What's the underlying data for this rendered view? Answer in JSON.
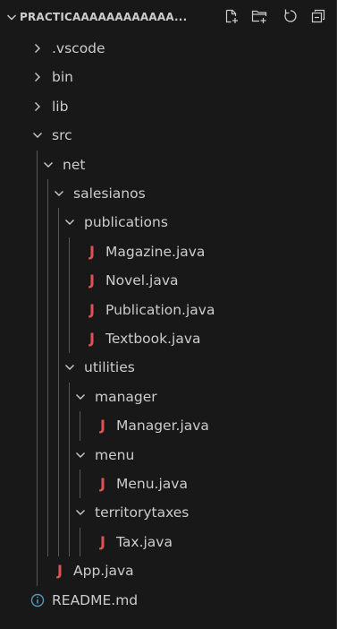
{
  "explorer": {
    "folder_title": "PRACTICAAAAAAAAAAAA...",
    "toolbar": {
      "new_file": "new-file-icon",
      "new_folder": "new-folder-icon",
      "refresh": "refresh-icon",
      "collapse": "collapse-all-icon"
    },
    "items": [
      {
        "label": ".vscode",
        "type": "folder",
        "expanded": false,
        "depth": 0
      },
      {
        "label": "bin",
        "type": "folder",
        "expanded": false,
        "depth": 0
      },
      {
        "label": "lib",
        "type": "folder",
        "expanded": false,
        "depth": 0
      },
      {
        "label": "src",
        "type": "folder",
        "expanded": true,
        "depth": 0
      },
      {
        "label": "net",
        "type": "folder",
        "expanded": true,
        "depth": 1
      },
      {
        "label": "salesianos",
        "type": "folder",
        "expanded": true,
        "depth": 2
      },
      {
        "label": "publications",
        "type": "folder",
        "expanded": true,
        "depth": 3
      },
      {
        "label": "Magazine.java",
        "type": "java",
        "depth": 4
      },
      {
        "label": "Novel.java",
        "type": "java",
        "depth": 4
      },
      {
        "label": "Publication.java",
        "type": "java",
        "depth": 4
      },
      {
        "label": "Textbook.java",
        "type": "java",
        "depth": 4
      },
      {
        "label": "utilities",
        "type": "folder",
        "expanded": true,
        "depth": 3
      },
      {
        "label": "manager",
        "type": "folder",
        "expanded": true,
        "depth": 4
      },
      {
        "label": "Manager.java",
        "type": "java",
        "depth": 5
      },
      {
        "label": "menu",
        "type": "folder",
        "expanded": true,
        "depth": 4
      },
      {
        "label": "Menu.java",
        "type": "java",
        "depth": 5
      },
      {
        "label": "territorytaxes",
        "type": "folder",
        "expanded": true,
        "depth": 4
      },
      {
        "label": "Tax.java",
        "type": "java",
        "depth": 5
      },
      {
        "label": "App.java",
        "type": "java",
        "depth": 1
      },
      {
        "label": "README.md",
        "type": "info",
        "depth": 0
      }
    ],
    "java_icon_glyph": "J",
    "colors": {
      "background": "#181818",
      "text": "#cccccc",
      "java_icon": "#e05252",
      "info_icon": "#519aba",
      "indent_guide": "#585858"
    }
  }
}
